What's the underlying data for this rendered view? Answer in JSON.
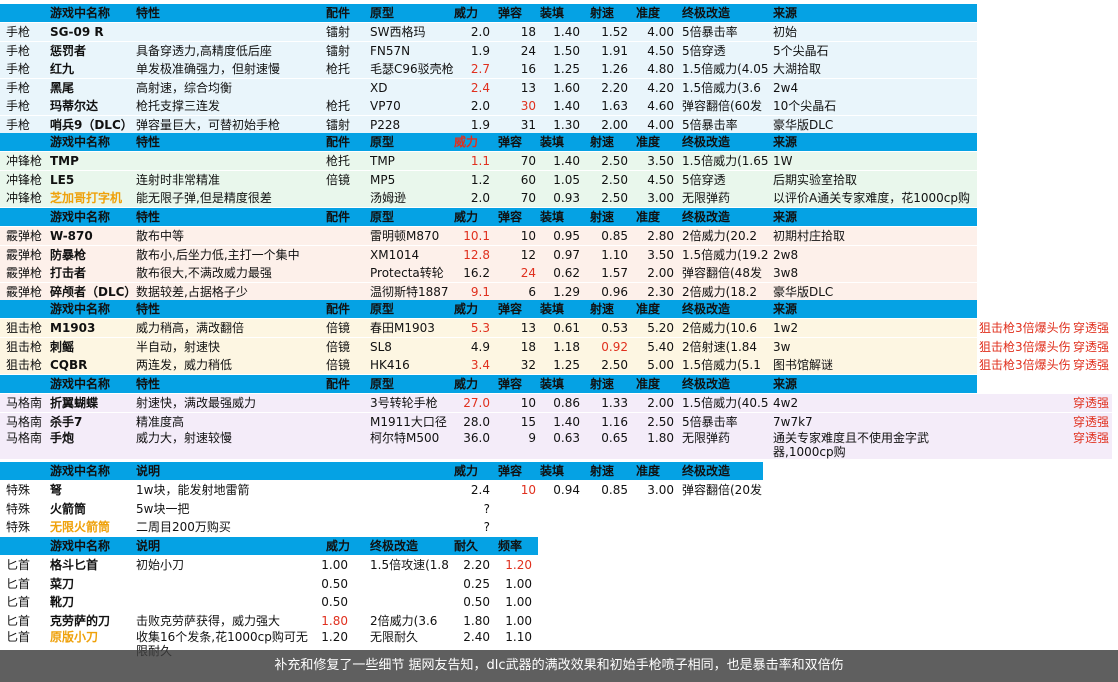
{
  "colors": {
    "header": "#05a2e4",
    "highlight_red": "#e0301e",
    "highlight_orange": "#efa10a"
  },
  "headers": {
    "main": [
      "游戏中名称",
      "特性",
      "配件",
      "原型",
      "威力",
      "弹容",
      "装填",
      "射速",
      "准度",
      "终极改造",
      "来源"
    ],
    "special": [
      "游戏中名称",
      "说明",
      "威力",
      "弹容",
      "装填",
      "射速",
      "准度",
      "终极改造"
    ],
    "knife": [
      "游戏中名称",
      "说明",
      "威力",
      "终极改造",
      "耐久",
      "频率"
    ]
  },
  "pistols": [
    {
      "type": "手枪",
      "name": "SG-09 R",
      "desc": "",
      "part": "镭射",
      "proto": "SW西格玛",
      "power": "2.0",
      "cap": "18",
      "reload": "1.40",
      "rate": "1.52",
      "acc": "4.00",
      "ult": "5倍暴击率",
      "src": "初始"
    },
    {
      "type": "手枪",
      "name": "惩罚者",
      "desc": "具备穿透力,高精度低后座",
      "part": "镭射",
      "proto": "FN57N",
      "power": "1.9",
      "cap": "24",
      "reload": "1.50",
      "rate": "1.91",
      "acc": "4.50",
      "ult": "5倍穿透",
      "src": "5个尖晶石"
    },
    {
      "type": "手枪",
      "name": "红九",
      "desc": "单发极准确强力，但射速慢",
      "part": "枪托",
      "proto": "毛瑟C96驳壳枪",
      "power": "2.7",
      "cap": "16",
      "reload": "1.25",
      "rate": "1.26",
      "acc": "4.80",
      "ult": "1.5倍威力(4.05",
      "src": "大湖拾取"
    },
    {
      "type": "手枪",
      "name": "黑尾",
      "desc": "高射速，综合均衡",
      "part": "",
      "proto": "XD",
      "power": "2.4",
      "cap": "13",
      "reload": "1.60",
      "rate": "2.20",
      "acc": "4.20",
      "ult": "1.5倍威力(3.6",
      "src": "2w4"
    },
    {
      "type": "手枪",
      "name": "玛蒂尔达",
      "desc": "枪托支撑三连发",
      "part": "枪托",
      "proto": "VP70",
      "power": "2.0",
      "cap": "30",
      "reload": "1.40",
      "rate": "1.63",
      "acc": "4.60",
      "ult": "弹容翻倍(60发",
      "src": "10个尖晶石"
    },
    {
      "type": "手枪",
      "name": "哨兵9（DLC）",
      "desc": "弹容量巨大，可替初始手枪",
      "part": "镭射",
      "proto": "P228",
      "power": "1.9",
      "cap": "31",
      "reload": "1.30",
      "rate": "2.00",
      "acc": "4.00",
      "ult": "5倍暴击率",
      "src": "豪华版DLC"
    }
  ],
  "smgs": [
    {
      "type": "冲锋枪",
      "name": "TMP",
      "desc": "",
      "part": "枪托",
      "proto": "TMP",
      "power": "1.1",
      "cap": "70",
      "reload": "1.40",
      "rate": "2.50",
      "acc": "3.50",
      "ult": "1.5倍威力(1.65",
      "src": "1W"
    },
    {
      "type": "冲锋枪",
      "name": "LE5",
      "desc": "连射时非常精准",
      "part": "倍镜",
      "proto": "MP5",
      "power": "1.2",
      "cap": "60",
      "reload": "1.05",
      "rate": "2.50",
      "acc": "4.50",
      "ult": "5倍穿透",
      "src": "后期实验室拾取"
    },
    {
      "type": "冲锋枪",
      "name": "芝加哥打字机",
      "desc": "能无限子弹,但是精度很差",
      "part": "",
      "proto": "汤姆逊",
      "power": "2.0",
      "cap": "70",
      "reload": "0.93",
      "rate": "2.50",
      "acc": "3.00",
      "ult": "无限弹药",
      "src": "以评价A通关专家难度，花1000cp购"
    }
  ],
  "shotguns": [
    {
      "type": "霰弹枪",
      "name": "W-870",
      "desc": "散布中等",
      "part": "",
      "proto": "雷明顿M870",
      "power": "10.1",
      "cap": "10",
      "reload": "0.95",
      "rate": "0.85",
      "acc": "2.80",
      "ult": "2倍威力(20.2",
      "src": "初期村庄拾取"
    },
    {
      "type": "霰弹枪",
      "name": "防暴枪",
      "desc": "散布小,后坐力低,主打一个集中",
      "part": "",
      "proto": "XM1014",
      "power": "12.8",
      "cap": "12",
      "reload": "0.97",
      "rate": "1.10",
      "acc": "3.50",
      "ult": "1.5倍威力(19.2",
      "src": "2w8"
    },
    {
      "type": "霰弹枪",
      "name": "打击者",
      "desc": "散布很大,不满改威力最强",
      "part": "",
      "proto": "Protecta转轮",
      "power": "16.2",
      "cap": "24",
      "reload": "0.62",
      "rate": "1.57",
      "acc": "2.00",
      "ult": "弹容翻倍(48发",
      "src": "3w8"
    },
    {
      "type": "霰弹枪",
      "name": "碎颅者（DLC）",
      "desc": "数据较差,占据格子少",
      "part": "",
      "proto": "温彻斯特1887",
      "power": "9.1",
      "cap": "6",
      "reload": "1.29",
      "rate": "0.96",
      "acc": "2.30",
      "ult": "2倍威力(18.2",
      "src": "豪华版DLC"
    }
  ],
  "snipers": [
    {
      "type": "狙击枪",
      "name": "M1903",
      "desc": "威力稍高，满改翻倍",
      "part": "倍镜",
      "proto": "春田M1903",
      "power": "5.3",
      "cap": "13",
      "reload": "0.61",
      "rate": "0.53",
      "acc": "5.20",
      "ult": "2倍威力(10.6",
      "src": "1w2",
      "note": "狙击枪3倍爆头伤",
      "note2": "穿透强"
    },
    {
      "type": "狙击枪",
      "name": "刺鳐",
      "desc": "半自动，射速快",
      "part": "倍镜",
      "proto": "SL8",
      "power": "4.9",
      "cap": "18",
      "reload": "1.18",
      "rate": "0.92",
      "acc": "5.40",
      "ult": "2倍射速(1.84",
      "src": "3w",
      "note": "狙击枪3倍爆头伤",
      "note2": "穿透强"
    },
    {
      "type": "狙击枪",
      "name": "CQBR",
      "desc": "两连发，威力稍低",
      "part": "倍镜",
      "proto": "HK416",
      "power": "3.4",
      "cap": "32",
      "reload": "1.25",
      "rate": "2.50",
      "acc": "5.00",
      "ult": "1.5倍威力(5.1",
      "src": "图书馆解谜",
      "note": "狙击枪3倍爆头伤",
      "note2": "穿透强"
    }
  ],
  "magnums": [
    {
      "type": "马格南",
      "name": "折翼蝴蝶",
      "desc": "射速快，满改最强威力",
      "part": "",
      "proto": "3号转轮手枪",
      "power": "27.0",
      "cap": "10",
      "reload": "0.86",
      "rate": "1.33",
      "acc": "2.00",
      "ult": "1.5倍威力(40.5",
      "src": "4w2",
      "note2": "穿透强"
    },
    {
      "type": "马格南",
      "name": "杀手7",
      "desc": "精准度高",
      "part": "",
      "proto": "M1911大口径",
      "power": "28.0",
      "cap": "15",
      "reload": "1.40",
      "rate": "1.16",
      "acc": "2.50",
      "ult": "5倍暴击率",
      "src": "7w7k7",
      "note2": "穿透强"
    },
    {
      "type": "马格南",
      "name": "手炮",
      "desc": "威力大，射速较慢",
      "part": "",
      "proto": "柯尔特M500",
      "power": "36.0",
      "cap": "9",
      "reload": "0.63",
      "rate": "0.65",
      "acc": "1.80",
      "ult": "无限弹药",
      "src": "通关专家难度且不使用金字武器,1000cp购",
      "note2": "穿透强"
    }
  ],
  "specials": [
    {
      "type": "特殊",
      "name": "弩",
      "desc": "1w块，能发射地雷箭",
      "power": "2.4",
      "cap": "10",
      "reload": "0.94",
      "rate": "0.85",
      "acc": "3.00",
      "ult": "弹容翻倍(20发"
    },
    {
      "type": "特殊",
      "name": "火箭筒",
      "desc": "5w块一把",
      "power": "?",
      "cap": "",
      "reload": "",
      "rate": "",
      "acc": "",
      "ult": ""
    },
    {
      "type": "特殊",
      "name": "无限火箭筒",
      "desc": "二周目200万购买",
      "power": "?",
      "cap": "",
      "reload": "",
      "rate": "",
      "acc": "",
      "ult": ""
    }
  ],
  "knives": [
    {
      "type": "匕首",
      "name": "格斗匕首",
      "desc": "初始小刀",
      "power": "1.00",
      "ult": "1.5倍攻速(1.8",
      "dur": "2.20",
      "freq": "1.20"
    },
    {
      "type": "匕首",
      "name": "菜刀",
      "desc": "",
      "power": "0.50",
      "ult": "",
      "dur": "0.25",
      "freq": "1.00"
    },
    {
      "type": "匕首",
      "name": "靴刀",
      "desc": "",
      "power": "0.50",
      "ult": "",
      "dur": "0.50",
      "freq": "1.00"
    },
    {
      "type": "匕首",
      "name": "克劳萨的刀",
      "desc": "击败克劳萨获得，威力强大",
      "power": "1.80",
      "ult": "2倍威力(3.6",
      "dur": "1.80",
      "freq": "1.00"
    },
    {
      "type": "匕首",
      "name": "原版小刀",
      "desc": "收集16个发条,花1000cp购可无限耐久",
      "power": "1.20",
      "ult": "无限耐久",
      "dur": "2.40",
      "freq": "1.10"
    }
  ],
  "caption": "补充和修复了一些细节 据网友告知，dlc武器的满改效果和初始手枪喷子相同，也是暴击率和双倍伤"
}
